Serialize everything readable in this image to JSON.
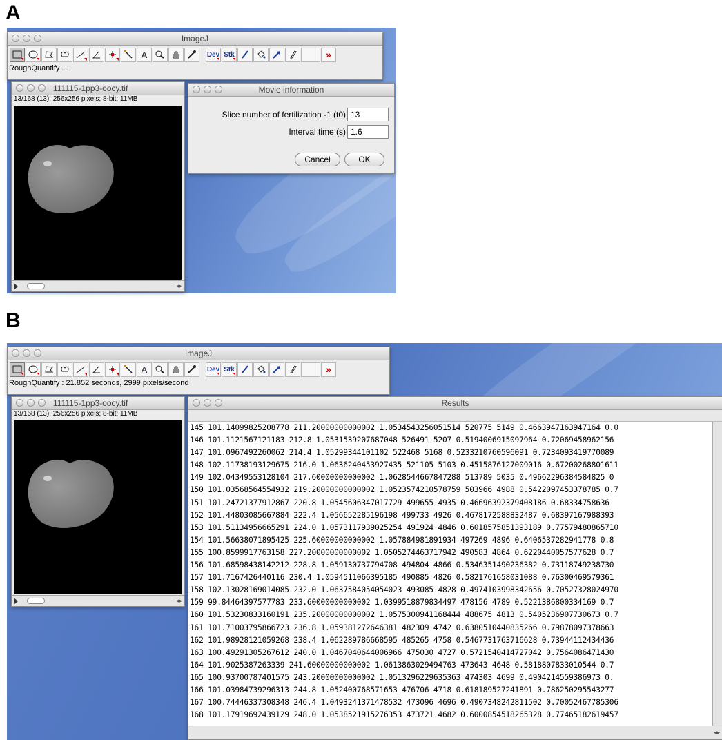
{
  "panels": {
    "a": "A",
    "b": "B"
  },
  "imagej": {
    "title": "ImageJ",
    "tools": [
      "rectangle-tool",
      "oval-tool",
      "polygon-tool",
      "freehand-tool",
      "line-tool",
      "angle-tool",
      "point-tool",
      "wand-tool",
      "text-tool",
      "magnifier-tool",
      "hand-tool",
      "color-picker-tool",
      "dev-menu",
      "stk-menu",
      "brush-tool",
      "flood-fill-tool",
      "arrow-tool",
      "pencil-tool",
      "more-tools"
    ],
    "tool_text": {
      "text": "A",
      "dev": "Dev",
      "stk": "Stk",
      "more": "»"
    },
    "status_a": "RoughQuantify ...",
    "status_b": "RoughQuantify : 21.852 seconds, 2999 pixels/second"
  },
  "image_window": {
    "title": "111115-1pp3-oocy.tif",
    "info": "13/168 (13); 256x256 pixels; 8-bit; 11MB"
  },
  "dialog": {
    "title": "Movie information",
    "field1_label": "Slice number of fertilization -1 (t0)",
    "field1_value": "13",
    "field2_label": "Interval time (s)",
    "field2_value": "1.6",
    "cancel": "Cancel",
    "ok": "OK"
  },
  "results": {
    "title": "Results",
    "rows": [
      "145 101.14099825208778 211.20000000000002 1.0534543256051514 520775 5149 0.4663947163947164 0.0",
      "146 101.1121567121183 212.8 1.0531539207687048 526491 5207 0.5194006915097964 0.72069458962156",
      "147 101.0967492260062 214.4 1.05299344101102 522468 5168 0.5233210760596091 0.7234093419770089",
      "148 102.11738193129675 216.0 1.0636240453927435 521105 5103 0.4515876127009016 0.67200268801611",
      "149 102.04349553128104 217.60000000000002 1.0628544667847288 513789 5035 0.49662296384584825 0",
      "150 101.03568564554932 219.20000000000002 1.0523574210578759 503966 4988 0.5422097453378785 0.7",
      "151 101.24721377912867 220.8 1.0545606347017729 499655 4935 0.46696392379408186 0.68334758636",
      "152 101.44803085667884 222.4 1.056652285196198 499733 4926 0.4678172588832487 0.68397167988393",
      "153 101.51134956665291 224.0 1.0573117939025254 491924 4846 0.6018575851393189 0.77579480865710",
      "154 101.56638071895425 225.60000000000002 1.057884981891934 497269 4896 0.6406537282941778 0.8",
      "155 100.8599917763158 227.20000000000002 1.0505274463717942 490583 4864 0.6220440057577628 0.7",
      "156 101.68598438142212 228.8 1.059130737794708 494804 4866 0.5346351490236382 0.73118749238730",
      "157 101.7167426440116 230.4 1.0594511066395185 490885 4826 0.5821761658031088 0.76300469579361",
      "158 102.13028169014085 232.0 1.0637584054054023 493085 4828 0.4974103998342656 0.70527328024970",
      "159 99.84464397577783 233.60000000000002 1.0399518879834497 478156 4789 0.5221386800334169 0.7",
      "160 101.53230833160191 235.20000000000002 1.0575300941168444 488675 4813 0.5405236907730673 0.7",
      "161 101.71003795866723 236.8 1.059381272646381 482309 4742 0.6380510440835266 0.79878097378663",
      "162 101.98928121059268 238.4 1.062289786668595 485265 4758 0.5467731763716628 0.73944112434436",
      "163 100.49291305267612 240.0 1.0467040644006966 475030 4727 0.5721540414727042 0.7564086471430",
      "164 101.9025387263339 241.60000000000002 1.0613863029494763 473643 4648 0.5818807833010544 0.7",
      "165 100.93700787401575 243.20000000000002 1.0513296229635363 474303 4699 0.4904214559386973 0.",
      "166 101.03984739296313 244.8 1.052400768571653 476706 4718 0.618189527241891 0.786250295543277",
      "167 100.74446337308348 246.4 1.0493241371478532 473096 4696 0.4907348242811502 0.70052467785306",
      "168 101.17919692439129 248.0 1.0538521915276353 473721 4682 0.6000854518265328 0.77465182619457"
    ]
  },
  "colors": {
    "desktop": "#5b7fc7",
    "tool_accent": "#1a3c9a",
    "more": "#cc0000"
  }
}
